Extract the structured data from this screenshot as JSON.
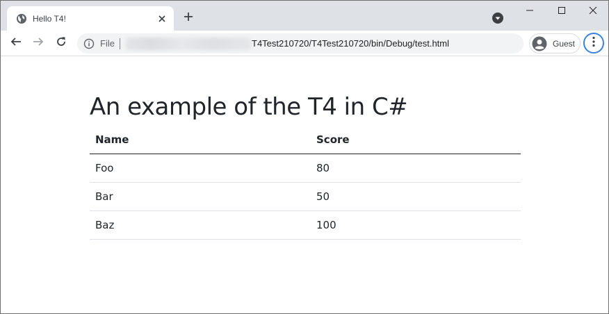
{
  "browser": {
    "tab": {
      "title": "Hello T4!"
    },
    "address": {
      "scheme_label": "File",
      "url_visible": "T4Test210720/T4Test210720/bin/Debug/test.html"
    },
    "profile": {
      "label": "Guest"
    }
  },
  "page": {
    "heading": "An example of the T4 in C#",
    "table": {
      "headers": [
        "Name",
        "Score"
      ],
      "rows": [
        [
          "Foo",
          "80"
        ],
        [
          "Bar",
          "50"
        ],
        [
          "Baz",
          "100"
        ]
      ]
    }
  },
  "colors": {
    "tabstrip": "#dee1e6",
    "omnibox": "#f1f3f4",
    "focus_ring": "#3b82dc",
    "text": "#212529"
  },
  "icons": [
    "globe-icon",
    "close-icon",
    "plus-icon",
    "tab-search-icon",
    "minimize-icon",
    "maximize-icon",
    "close-window-icon",
    "back-arrow-icon",
    "forward-arrow-icon",
    "reload-icon",
    "info-icon",
    "account-icon",
    "kebab-menu-icon"
  ]
}
